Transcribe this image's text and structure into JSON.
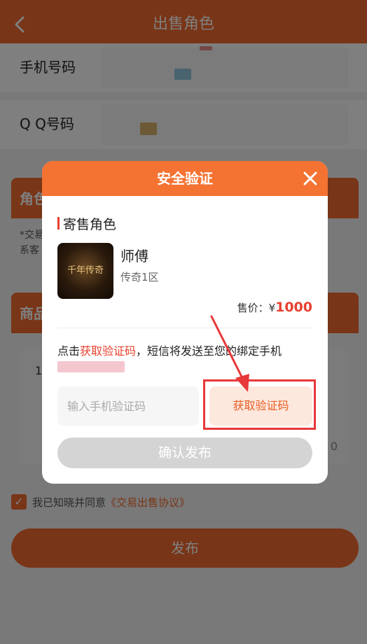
{
  "topbar": {
    "title": "出售角色"
  },
  "form": {
    "phone_label": "手机号码",
    "qq_label": "Q Q号码"
  },
  "background": {
    "section1_partial": "角色",
    "note_partial": "*交易\n系客",
    "section2_partial": "商品",
    "desc_number": "1",
    "desc_count": "0",
    "agree_prefix": "我已知晓并同意",
    "agree_link": "《交易出售协议》",
    "publish_label": "发布"
  },
  "modal": {
    "title": "安全验证",
    "section_title": "寄售角色",
    "game_icon_text": "千年传奇",
    "item_name": "师傅",
    "item_server": "传奇1区",
    "price_label": "售价：¥",
    "price_value": "1000",
    "sms_prefix": "点击",
    "sms_link": "获取验证码",
    "sms_suffix": "，短信将发送至您的绑定手机",
    "code_placeholder": "输入手机验证码",
    "get_code_label": "获取验证码",
    "confirm_label": "确认发布"
  },
  "colors": {
    "accent": "#f26a2e",
    "highlight": "#e8383a"
  }
}
